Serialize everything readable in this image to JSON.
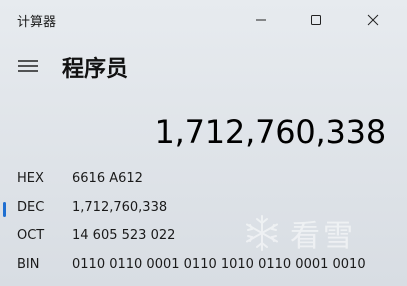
{
  "window": {
    "title": "计算器"
  },
  "header": {
    "mode_title": "程序员"
  },
  "display": {
    "value": "1,712,760,338"
  },
  "radix": [
    {
      "name": "HEX",
      "value": "6616 A612",
      "selected": false
    },
    {
      "name": "DEC",
      "value": "1,712,760,338",
      "selected": true
    },
    {
      "name": "OCT",
      "value": "14 605 523 022",
      "selected": false
    },
    {
      "name": "BIN",
      "value": "0110 0110 0001 0110 1010 0110 0001 0010",
      "selected": false
    }
  ],
  "watermark": {
    "text": "看雪",
    "icon": "snowflake-icon"
  },
  "colors": {
    "accent": "#1f6fd1",
    "background": "#dfe3e8"
  }
}
